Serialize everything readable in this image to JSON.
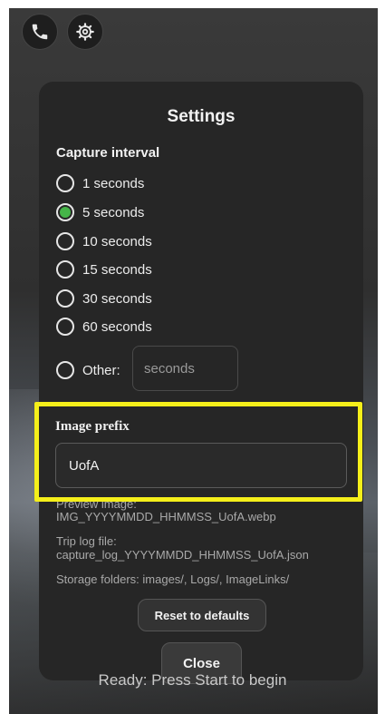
{
  "top_buttons": {
    "call_icon": "phone-icon",
    "settings_icon": "gear-icon"
  },
  "dialog": {
    "title": "Settings",
    "capture_interval": {
      "label": "Capture interval",
      "options": [
        {
          "label": "1 seconds",
          "selected": false
        },
        {
          "label": "5 seconds",
          "selected": true
        },
        {
          "label": "10 seconds",
          "selected": false
        },
        {
          "label": "15 seconds",
          "selected": false
        },
        {
          "label": "30 seconds",
          "selected": false
        },
        {
          "label": "60 seconds",
          "selected": false
        }
      ],
      "other_label": "Other:",
      "other_placeholder": "seconds"
    },
    "image_prefix": {
      "label": "Image prefix",
      "value": "UofA"
    },
    "preview_image_label": "Preview image:",
    "preview_image_value": "IMG_YYYYMMDD_HHMMSS_UofA.webp",
    "trip_log_label": "Trip log file:",
    "trip_log_value": "capture_log_YYYYMMDD_HHMMSS_UofA.json",
    "storage_folders": "Storage folders: images/, Logs/, ImageLinks/",
    "reset_label": "Reset to defaults",
    "close_label": "Close"
  },
  "status_text": "Ready: Press Start to begin",
  "colors": {
    "accent_green": "#45b548",
    "highlight_yellow": "#f5ef1a",
    "dialog_bg": "#262626"
  }
}
